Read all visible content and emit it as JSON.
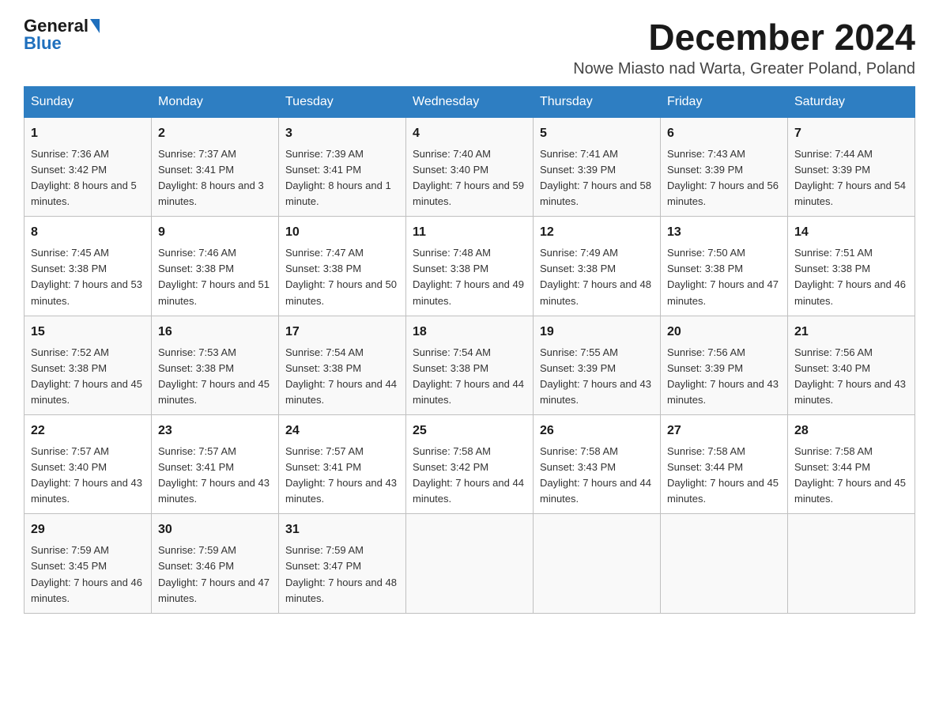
{
  "header": {
    "logo": {
      "general": "General",
      "blue": "Blue"
    },
    "title": "December 2024",
    "location": "Nowe Miasto nad Warta, Greater Poland, Poland"
  },
  "weekdays": [
    "Sunday",
    "Monday",
    "Tuesday",
    "Wednesday",
    "Thursday",
    "Friday",
    "Saturday"
  ],
  "weeks": [
    [
      {
        "day": "1",
        "sunrise": "7:36 AM",
        "sunset": "3:42 PM",
        "daylight": "8 hours and 5 minutes."
      },
      {
        "day": "2",
        "sunrise": "7:37 AM",
        "sunset": "3:41 PM",
        "daylight": "8 hours and 3 minutes."
      },
      {
        "day": "3",
        "sunrise": "7:39 AM",
        "sunset": "3:41 PM",
        "daylight": "8 hours and 1 minute."
      },
      {
        "day": "4",
        "sunrise": "7:40 AM",
        "sunset": "3:40 PM",
        "daylight": "7 hours and 59 minutes."
      },
      {
        "day": "5",
        "sunrise": "7:41 AM",
        "sunset": "3:39 PM",
        "daylight": "7 hours and 58 minutes."
      },
      {
        "day": "6",
        "sunrise": "7:43 AM",
        "sunset": "3:39 PM",
        "daylight": "7 hours and 56 minutes."
      },
      {
        "day": "7",
        "sunrise": "7:44 AM",
        "sunset": "3:39 PM",
        "daylight": "7 hours and 54 minutes."
      }
    ],
    [
      {
        "day": "8",
        "sunrise": "7:45 AM",
        "sunset": "3:38 PM",
        "daylight": "7 hours and 53 minutes."
      },
      {
        "day": "9",
        "sunrise": "7:46 AM",
        "sunset": "3:38 PM",
        "daylight": "7 hours and 51 minutes."
      },
      {
        "day": "10",
        "sunrise": "7:47 AM",
        "sunset": "3:38 PM",
        "daylight": "7 hours and 50 minutes."
      },
      {
        "day": "11",
        "sunrise": "7:48 AM",
        "sunset": "3:38 PM",
        "daylight": "7 hours and 49 minutes."
      },
      {
        "day": "12",
        "sunrise": "7:49 AM",
        "sunset": "3:38 PM",
        "daylight": "7 hours and 48 minutes."
      },
      {
        "day": "13",
        "sunrise": "7:50 AM",
        "sunset": "3:38 PM",
        "daylight": "7 hours and 47 minutes."
      },
      {
        "day": "14",
        "sunrise": "7:51 AM",
        "sunset": "3:38 PM",
        "daylight": "7 hours and 46 minutes."
      }
    ],
    [
      {
        "day": "15",
        "sunrise": "7:52 AM",
        "sunset": "3:38 PM",
        "daylight": "7 hours and 45 minutes."
      },
      {
        "day": "16",
        "sunrise": "7:53 AM",
        "sunset": "3:38 PM",
        "daylight": "7 hours and 45 minutes."
      },
      {
        "day": "17",
        "sunrise": "7:54 AM",
        "sunset": "3:38 PM",
        "daylight": "7 hours and 44 minutes."
      },
      {
        "day": "18",
        "sunrise": "7:54 AM",
        "sunset": "3:38 PM",
        "daylight": "7 hours and 44 minutes."
      },
      {
        "day": "19",
        "sunrise": "7:55 AM",
        "sunset": "3:39 PM",
        "daylight": "7 hours and 43 minutes."
      },
      {
        "day": "20",
        "sunrise": "7:56 AM",
        "sunset": "3:39 PM",
        "daylight": "7 hours and 43 minutes."
      },
      {
        "day": "21",
        "sunrise": "7:56 AM",
        "sunset": "3:40 PM",
        "daylight": "7 hours and 43 minutes."
      }
    ],
    [
      {
        "day": "22",
        "sunrise": "7:57 AM",
        "sunset": "3:40 PM",
        "daylight": "7 hours and 43 minutes."
      },
      {
        "day": "23",
        "sunrise": "7:57 AM",
        "sunset": "3:41 PM",
        "daylight": "7 hours and 43 minutes."
      },
      {
        "day": "24",
        "sunrise": "7:57 AM",
        "sunset": "3:41 PM",
        "daylight": "7 hours and 43 minutes."
      },
      {
        "day": "25",
        "sunrise": "7:58 AM",
        "sunset": "3:42 PM",
        "daylight": "7 hours and 44 minutes."
      },
      {
        "day": "26",
        "sunrise": "7:58 AM",
        "sunset": "3:43 PM",
        "daylight": "7 hours and 44 minutes."
      },
      {
        "day": "27",
        "sunrise": "7:58 AM",
        "sunset": "3:44 PM",
        "daylight": "7 hours and 45 minutes."
      },
      {
        "day": "28",
        "sunrise": "7:58 AM",
        "sunset": "3:44 PM",
        "daylight": "7 hours and 45 minutes."
      }
    ],
    [
      {
        "day": "29",
        "sunrise": "7:59 AM",
        "sunset": "3:45 PM",
        "daylight": "7 hours and 46 minutes."
      },
      {
        "day": "30",
        "sunrise": "7:59 AM",
        "sunset": "3:46 PM",
        "daylight": "7 hours and 47 minutes."
      },
      {
        "day": "31",
        "sunrise": "7:59 AM",
        "sunset": "3:47 PM",
        "daylight": "7 hours and 48 minutes."
      },
      null,
      null,
      null,
      null
    ]
  ]
}
